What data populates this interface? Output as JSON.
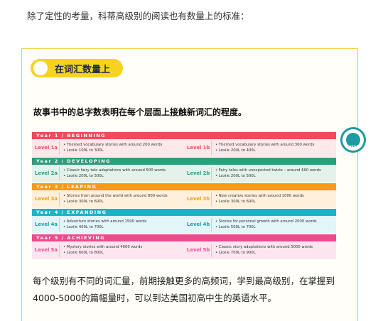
{
  "intro_text": "除了定性的考量，科蒂高级别的阅读也有数量上的标准：",
  "pill_label": "在词汇数量上",
  "headline": "故事书中的总字数表明在每个层面上接触新词汇的程度。",
  "logo_text": "LEXILE",
  "years": [
    {
      "band": "Year 1  /  BEGINNING",
      "band_color": "#ef4b5a",
      "row_bg": "#fde8ea",
      "level_color": "#ef4b5a",
      "a": {
        "level": "Level 1a",
        "lines": [
          "• Themed vocabulary stories with around 200 words",
          "• Lexile 100L to 300L"
        ]
      },
      "b": {
        "level": "Level 1b",
        "lines": [
          "• Themed vocabulary stories with around 300 words",
          "• Lexile 200L to 400L"
        ]
      }
    },
    {
      "band": "Year 2  /  DEVELOPING",
      "band_color": "#2e9d7c",
      "row_bg": "#e3f3ec",
      "level_color": "#2e9d7c",
      "a": {
        "level": "Level 2a",
        "lines": [
          "• Classic fairy tale adaptations with around 500 words",
          "• Lexile 200L to 500L"
        ]
      },
      "b": {
        "level": "Level 2b",
        "lines": [
          "• Fairy tales with unexpected twists – around 600 words",
          "• Lexile 200L to 500L"
        ]
      }
    },
    {
      "band": "Year 3  /  LEAPING",
      "band_color": "#f59a1c",
      "row_bg": "#fff0dc",
      "level_color": "#f59a1c",
      "a": {
        "level": "Level 3a",
        "lines": [
          "• Stories from around the world with around 800 words",
          "• Lexile 300L to 600L"
        ]
      },
      "b": {
        "level": "Level 3b",
        "lines": [
          "• New creative stories with around 1000 words",
          "• Lexile 300L to 600L"
        ]
      }
    },
    {
      "band": "Year 4  /  EXPANDING",
      "band_color": "#20b1c4",
      "row_bg": "#e2f5f8",
      "level_color": "#1a9fb1",
      "a": {
        "level": "Level 4a",
        "lines": [
          "• Adventure stories with around 1500 words",
          "• Lexile 400L to 700L"
        ]
      },
      "b": {
        "level": "Level 4b",
        "lines": [
          "• Stories for personal growth with around 2000 words",
          "• Lexile 500L to 700L"
        ]
      }
    },
    {
      "band": "Year 5  /  ACHIEVING",
      "band_color": "#ef4a8e",
      "row_bg": "#fde6ef",
      "level_color": "#ef4a8e",
      "a": {
        "level": "Level 5a",
        "lines": [
          "• Mystery stories with around 4000 words",
          "• Lexile 600L to 800L"
        ]
      },
      "b": {
        "level": "Level 5b",
        "lines": [
          "• Classic story adaptations with around 5000 words",
          "• Lexile 700L to 900L"
        ]
      }
    }
  ],
  "footer_text": "每个级别有不同的词汇量，前期接触更多的高频词，学到最高级别，在掌握到4000-5000的篇幅量时，可以到达美国初高中生的英语水平。"
}
